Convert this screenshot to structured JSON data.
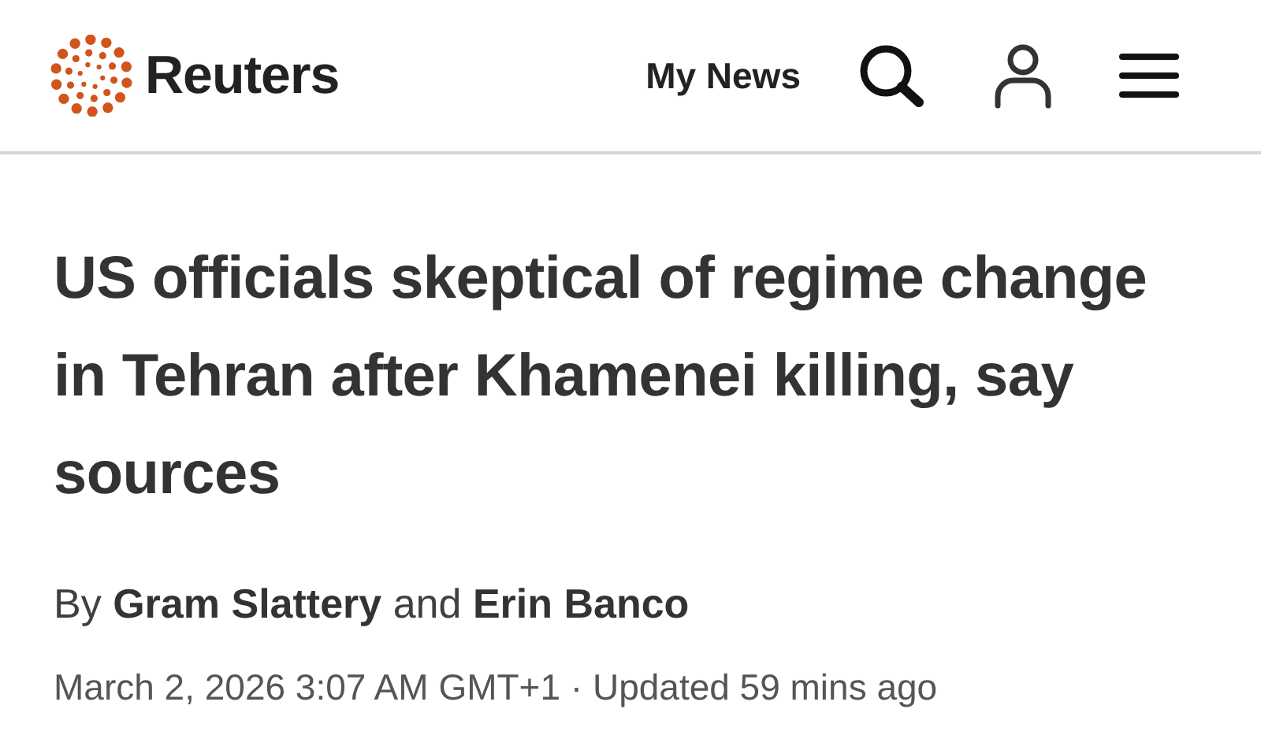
{
  "header": {
    "brand": "Reuters",
    "my_news": "My News"
  },
  "article": {
    "headline": "US officials skeptical of regime change in Tehran after Khamenei killing, say sources",
    "byline": "By **Gram Slattery** and **Erin Banco**",
    "dateline": "March 2, 2026 3:07 AM GMT+1 · Updated 59 mins ago"
  }
}
